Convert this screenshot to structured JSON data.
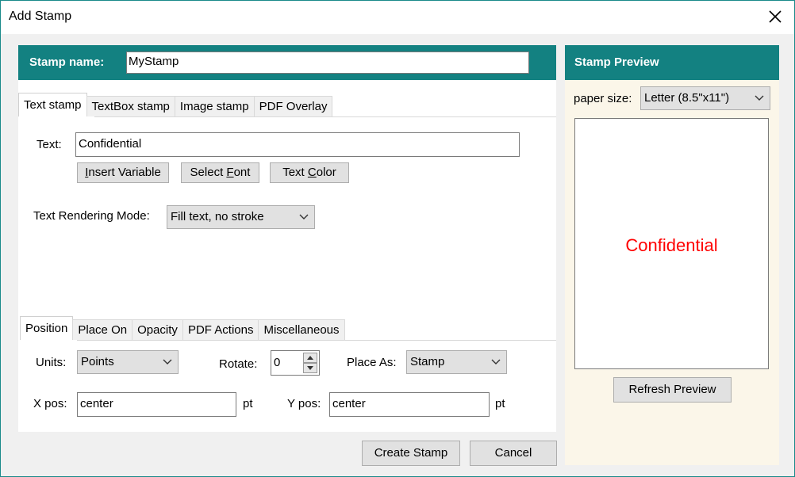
{
  "window": {
    "title": "Add Stamp"
  },
  "stamp_name": {
    "label": "Stamp name:",
    "value": "MyStamp"
  },
  "top_tabs": [
    {
      "label": "Text stamp",
      "active": true
    },
    {
      "label": "TextBox stamp",
      "active": false
    },
    {
      "label": "Image stamp",
      "active": false
    },
    {
      "label": "PDF Overlay",
      "active": false
    }
  ],
  "text_tab": {
    "text_label": "Text:",
    "text_value": "Confidential",
    "insert_variable": {
      "before": "",
      "key": "I",
      "after": "nsert Variable"
    },
    "select_font": {
      "before": "Select ",
      "key": "F",
      "after": "ont"
    },
    "text_color": {
      "before": "Text ",
      "key": "C",
      "after": "olor"
    },
    "rendering_mode_label": "Text Rendering Mode:",
    "rendering_mode_value": "Fill text, no stroke"
  },
  "bottom_tabs": [
    {
      "label": "Position",
      "active": true
    },
    {
      "label": "Place On",
      "active": false
    },
    {
      "label": "Opacity",
      "active": false
    },
    {
      "label": "PDF Actions",
      "active": false
    },
    {
      "label": "Miscellaneous",
      "active": false
    }
  ],
  "position": {
    "units_label": "Units:",
    "units_value": "Points",
    "rotate_label": "Rotate:",
    "rotate_value": "0",
    "place_as_label": "Place As:",
    "place_as_value": "Stamp",
    "xpos_label": "X pos:",
    "xpos_value": "center",
    "xpos_unit": "pt",
    "ypos_label": "Y pos:",
    "ypos_value": "center",
    "ypos_unit": "pt"
  },
  "actions": {
    "create": "Create Stamp",
    "cancel": "Cancel"
  },
  "preview": {
    "title": "Stamp Preview",
    "paper_size_label": "paper size:",
    "paper_size_value": "Letter (8.5\"x11\")",
    "preview_text": "Confidential",
    "preview_text_color": "#ff0000",
    "refresh_label": "Refresh Preview"
  },
  "colors": {
    "header_teal": "#138181",
    "preview_panel_bg": "#fbf6e9",
    "window_border": "#1a8a8a"
  }
}
